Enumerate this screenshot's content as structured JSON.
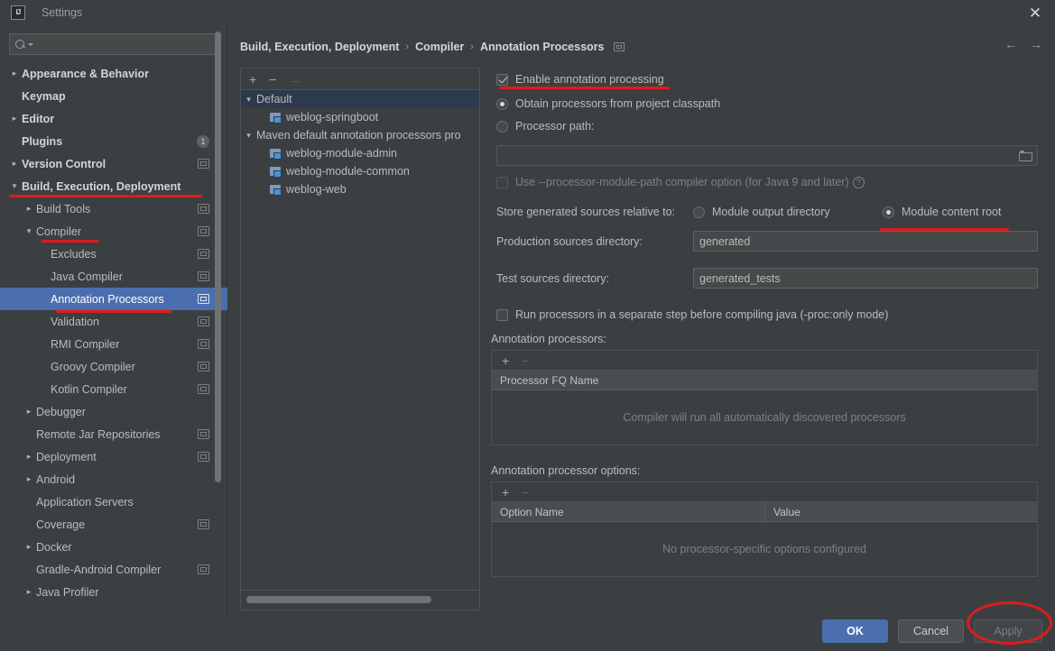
{
  "window": {
    "title": "Settings",
    "logo_text": "IJ",
    "close_icon": "✕"
  },
  "search": {
    "placeholder": "",
    "value": "",
    "icon": "search-icon"
  },
  "sidebar": {
    "items": [
      {
        "label": "Appearance & Behavior",
        "arrow": "›",
        "indent": 0,
        "bold": true,
        "badge": null,
        "project_icon": false,
        "selected": false
      },
      {
        "label": "Keymap",
        "arrow": "",
        "indent": 0,
        "bold": true,
        "badge": null,
        "project_icon": false,
        "selected": false
      },
      {
        "label": "Editor",
        "arrow": "›",
        "indent": 0,
        "bold": true,
        "badge": null,
        "project_icon": false,
        "selected": false
      },
      {
        "label": "Plugins",
        "arrow": "",
        "indent": 0,
        "bold": true,
        "badge": "1",
        "project_icon": false,
        "selected": false
      },
      {
        "label": "Version Control",
        "arrow": "›",
        "indent": 0,
        "bold": true,
        "badge": null,
        "project_icon": true,
        "selected": false
      },
      {
        "label": "Build, Execution, Deployment",
        "arrow": "⌄",
        "indent": 0,
        "bold": true,
        "badge": null,
        "project_icon": false,
        "selected": false
      },
      {
        "label": "Build Tools",
        "arrow": "›",
        "indent": 1,
        "bold": false,
        "badge": null,
        "project_icon": true,
        "selected": false
      },
      {
        "label": "Compiler",
        "arrow": "⌄",
        "indent": 1,
        "bold": false,
        "badge": null,
        "project_icon": true,
        "selected": false
      },
      {
        "label": "Excludes",
        "arrow": "",
        "indent": 2,
        "bold": false,
        "badge": null,
        "project_icon": true,
        "selected": false
      },
      {
        "label": "Java Compiler",
        "arrow": "",
        "indent": 2,
        "bold": false,
        "badge": null,
        "project_icon": true,
        "selected": false
      },
      {
        "label": "Annotation Processors",
        "arrow": "",
        "indent": 2,
        "bold": false,
        "badge": null,
        "project_icon": true,
        "selected": true
      },
      {
        "label": "Validation",
        "arrow": "",
        "indent": 2,
        "bold": false,
        "badge": null,
        "project_icon": true,
        "selected": false
      },
      {
        "label": "RMI Compiler",
        "arrow": "",
        "indent": 2,
        "bold": false,
        "badge": null,
        "project_icon": true,
        "selected": false
      },
      {
        "label": "Groovy Compiler",
        "arrow": "",
        "indent": 2,
        "bold": false,
        "badge": null,
        "project_icon": true,
        "selected": false
      },
      {
        "label": "Kotlin Compiler",
        "arrow": "",
        "indent": 2,
        "bold": false,
        "badge": null,
        "project_icon": true,
        "selected": false
      },
      {
        "label": "Debugger",
        "arrow": "›",
        "indent": 1,
        "bold": false,
        "badge": null,
        "project_icon": false,
        "selected": false
      },
      {
        "label": "Remote Jar Repositories",
        "arrow": "",
        "indent": 1,
        "bold": false,
        "badge": null,
        "project_icon": true,
        "selected": false
      },
      {
        "label": "Deployment",
        "arrow": "›",
        "indent": 1,
        "bold": false,
        "badge": null,
        "project_icon": true,
        "selected": false
      },
      {
        "label": "Android",
        "arrow": "›",
        "indent": 1,
        "bold": false,
        "badge": null,
        "project_icon": false,
        "selected": false
      },
      {
        "label": "Application Servers",
        "arrow": "",
        "indent": 1,
        "bold": false,
        "badge": null,
        "project_icon": false,
        "selected": false
      },
      {
        "label": "Coverage",
        "arrow": "",
        "indent": 1,
        "bold": false,
        "badge": null,
        "project_icon": true,
        "selected": false
      },
      {
        "label": "Docker",
        "arrow": "›",
        "indent": 1,
        "bold": false,
        "badge": null,
        "project_icon": false,
        "selected": false
      },
      {
        "label": "Gradle-Android Compiler",
        "arrow": "",
        "indent": 1,
        "bold": false,
        "badge": null,
        "project_icon": true,
        "selected": false
      },
      {
        "label": "Java Profiler",
        "arrow": "›",
        "indent": 1,
        "bold": false,
        "badge": null,
        "project_icon": false,
        "selected": false
      }
    ],
    "help_icon": "?"
  },
  "breadcrumb": {
    "part1": "Build, Execution, Deployment",
    "sep1": "›",
    "part2": "Compiler",
    "sep2": "›",
    "part3": "Annotation Processors",
    "project_scope_icon": "project-scope-icon"
  },
  "nav": {
    "back_icon": "←",
    "forward_icon": "→"
  },
  "module_panel": {
    "toolbar": {
      "add": "+",
      "remove": "−",
      "move": "→"
    },
    "rows": [
      {
        "label": "Default",
        "arrow": "⌄",
        "type": "group",
        "selected": true
      },
      {
        "label": "weblog-springboot",
        "arrow": "",
        "type": "module",
        "selected": false
      },
      {
        "label": "Maven default annotation processors pro",
        "arrow": "⌄",
        "type": "group",
        "selected": false
      },
      {
        "label": "weblog-module-admin",
        "arrow": "",
        "type": "module",
        "selected": false
      },
      {
        "label": "weblog-module-common",
        "arrow": "",
        "type": "module",
        "selected": false
      },
      {
        "label": "weblog-web",
        "arrow": "",
        "type": "module",
        "selected": false
      }
    ]
  },
  "settings": {
    "enable_annotation_processing": {
      "label": "Enable annotation processing",
      "checked": true
    },
    "obtain_from_classpath": {
      "label": "Obtain processors from project classpath",
      "selected": true
    },
    "processor_path": {
      "label": "Processor path:",
      "selected": false,
      "value": "",
      "browse_icon": "folder-icon"
    },
    "use_processor_module_path": {
      "label": "Use --processor-module-path compiler option (for Java 9 and later)",
      "checked": false,
      "help_icon": "?"
    },
    "store_relative_label": "Store generated sources relative to:",
    "store_module_output": {
      "label": "Module output directory",
      "selected": false
    },
    "store_module_content_root": {
      "label": "Module content root",
      "selected": true
    },
    "production_sources": {
      "label": "Production sources directory:",
      "value": "generated"
    },
    "test_sources": {
      "label": "Test sources directory:",
      "value": "generated_tests"
    },
    "run_separate_step": {
      "label": "Run processors in a separate step before compiling java (-proc:only mode)",
      "checked": false
    }
  },
  "processors_table": {
    "title": "Annotation processors:",
    "toolbar": {
      "add": "+",
      "remove": "−"
    },
    "columns": [
      "Processor FQ Name"
    ],
    "rows": [],
    "empty_text": "Compiler will run all automatically discovered processors"
  },
  "options_table": {
    "title": "Annotation processor options:",
    "toolbar": {
      "add": "+",
      "remove": "−"
    },
    "columns": [
      "Option Name",
      "Value"
    ],
    "rows": [],
    "empty_text": "No processor-specific options configured"
  },
  "buttons": {
    "ok": "OK",
    "cancel": "Cancel",
    "apply": "Apply"
  },
  "colors": {
    "background": "#3c3f41",
    "selection_blue": "#4b6eaf",
    "annotation_red": "#e01b1b",
    "text": "#bbbbbb"
  }
}
